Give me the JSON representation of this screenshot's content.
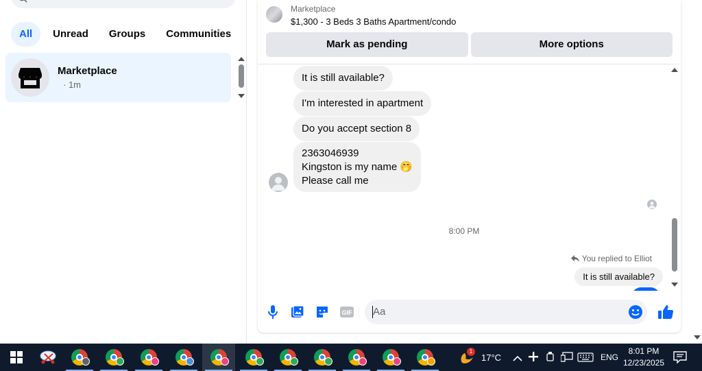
{
  "sidebar": {
    "filters": [
      "All",
      "Unread",
      "Groups",
      "Communities"
    ],
    "conversation": {
      "name": "Marketplace",
      "time": "· 1m"
    }
  },
  "header": {
    "category": "Marketplace",
    "listing_title": "$1,300 - 3 Beds 3 Baths Apartment/condo",
    "mark_pending_label": "Mark as pending",
    "more_options_label": "More options"
  },
  "thread": {
    "messages": [
      "It is still available?",
      "I'm interested in apartment",
      "Do you accept section 8"
    ],
    "last_message_lines": [
      "2363046939",
      "Kingston is my name",
      "Please call me"
    ],
    "last_message_emoji": "🤭",
    "time_separator": "8:00 PM",
    "reply_note": "You replied to Elliot",
    "outgoing_quote": "It is still available?"
  },
  "composer": {
    "placeholder": "Aa"
  },
  "colors": {
    "accent": "#0866ff",
    "bubble": "#f0f0f0",
    "taskbar": "#0f1b2d"
  },
  "taskbar": {
    "weather_badge": "1",
    "temperature": "17°C",
    "language": "ENG",
    "time": "8:01 PM",
    "date": "12/23/2025",
    "icons": [
      "windows-start-icon",
      "snipping-tool-icon",
      "chrome-icon",
      "chrome-profile-icon"
    ],
    "chrome_profiles": [
      "#5f6368",
      "#34a853",
      "#e8467c",
      "#4a90d9",
      "#e8467c",
      "#34a853",
      "#34a853",
      "#34a853",
      "#e8467c",
      "#e8467c",
      "#f4a300"
    ]
  }
}
